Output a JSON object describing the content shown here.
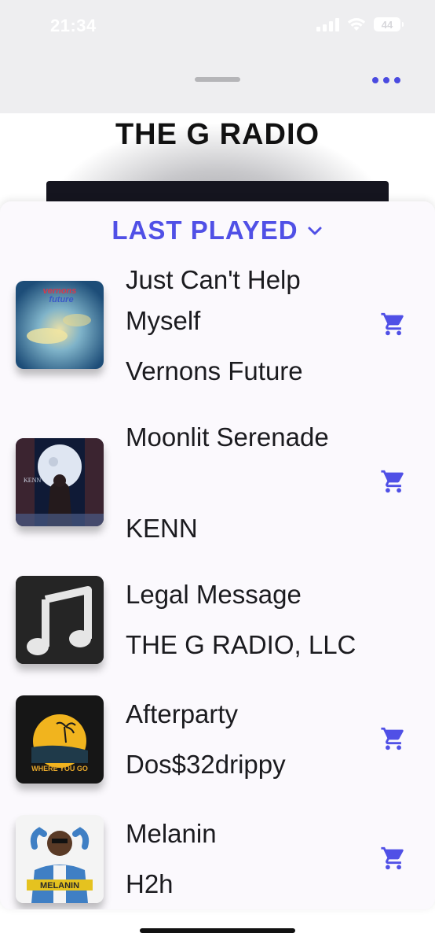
{
  "status_bar": {
    "time": "21:34",
    "battery": "44"
  },
  "header": {
    "more_icon": "more-dots-icon"
  },
  "station": {
    "title": "THE G RADIO"
  },
  "sheet": {
    "title": "LAST PLAYED",
    "accent_color": "#5050e6",
    "tracks": [
      {
        "title": "Just Can't Help Myself",
        "artist": "Vernons Future",
        "has_cart": true,
        "art": "vernons-future-cover"
      },
      {
        "title": "Moonlit Serenade",
        "artist": "KENN",
        "has_cart": true,
        "art": "kenn-moon-cover"
      },
      {
        "title": "Legal Message",
        "artist": "THE G RADIO, LLC",
        "has_cart": false,
        "art": "music-note-placeholder"
      },
      {
        "title": "Afterparty",
        "artist": "Dos$32drippy",
        "has_cart": true,
        "art": "afterparty-cover"
      },
      {
        "title": "Melanin",
        "artist": "H2h",
        "has_cart": true,
        "art": "melanin-cover"
      }
    ]
  }
}
